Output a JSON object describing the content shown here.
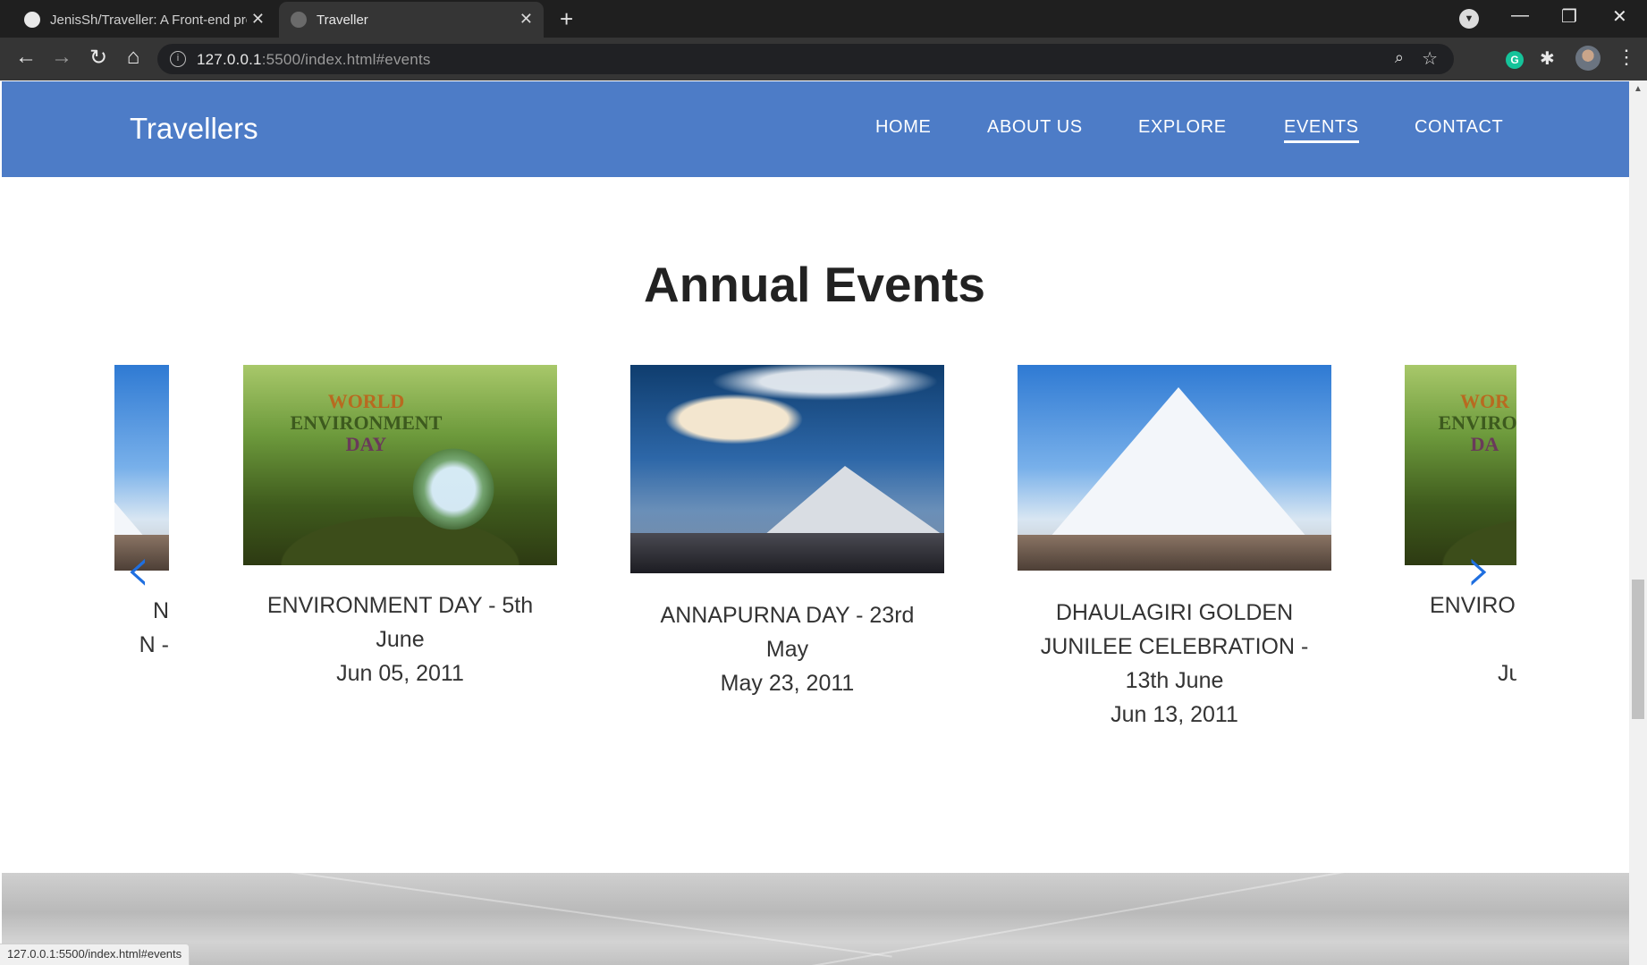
{
  "browser": {
    "tabs": [
      {
        "title": "JenisSh/Traveller: A Front-end pro",
        "active": false
      },
      {
        "title": "Traveller",
        "active": true
      }
    ],
    "url_host": "127.0.0.1",
    "url_rest": ":5500/index.html#events",
    "status_url": "127.0.0.1:5500/index.html#events"
  },
  "site": {
    "brand": "Travellers",
    "nav": [
      "HOME",
      "ABOUT US",
      "EXPLORE",
      "EVENTS",
      "CONTACT"
    ],
    "active_nav": "EVENTS"
  },
  "events": {
    "title": "Annual Events",
    "cards": [
      {
        "caption": "ENVIRONMENT DAY - 5th June",
        "date": "Jun 05, 2011",
        "image_text": [
          "WORLD",
          "ENVIRONMENT",
          "DAY"
        ]
      },
      {
        "caption": "ANNAPURNA DAY - 23rd May",
        "date": "May 23, 2011"
      },
      {
        "caption": "DHAULAGIRI GOLDEN JUNILEE CELEBRATION - 13th June",
        "date": "Jun 13, 2011"
      }
    ],
    "partial_left": {
      "line1": "N",
      "line2": "N -"
    },
    "partial_right": {
      "caption": "ENVIRO",
      "date": "Ju",
      "image_text": [
        "WOR",
        "ENVIRON",
        "DA"
      ]
    }
  },
  "colors": {
    "nav_bg": "#4d7cc7",
    "arrow": "#1f6fe0"
  }
}
